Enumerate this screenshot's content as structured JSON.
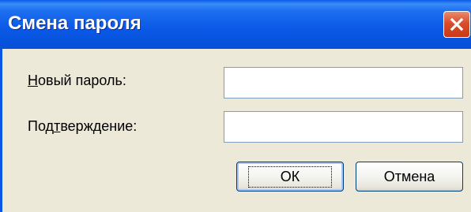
{
  "window": {
    "title": "Смена пароля"
  },
  "form": {
    "new_password": {
      "label_mnemonic": "Н",
      "label_rest": "овый пароль:",
      "value": ""
    },
    "confirm": {
      "label_pre": "Под",
      "label_mnemonic": "т",
      "label_rest": "верждение:",
      "value": ""
    }
  },
  "buttons": {
    "ok_label": "ОК",
    "cancel_label": "Отмена"
  },
  "icons": {
    "close": "close-icon"
  }
}
